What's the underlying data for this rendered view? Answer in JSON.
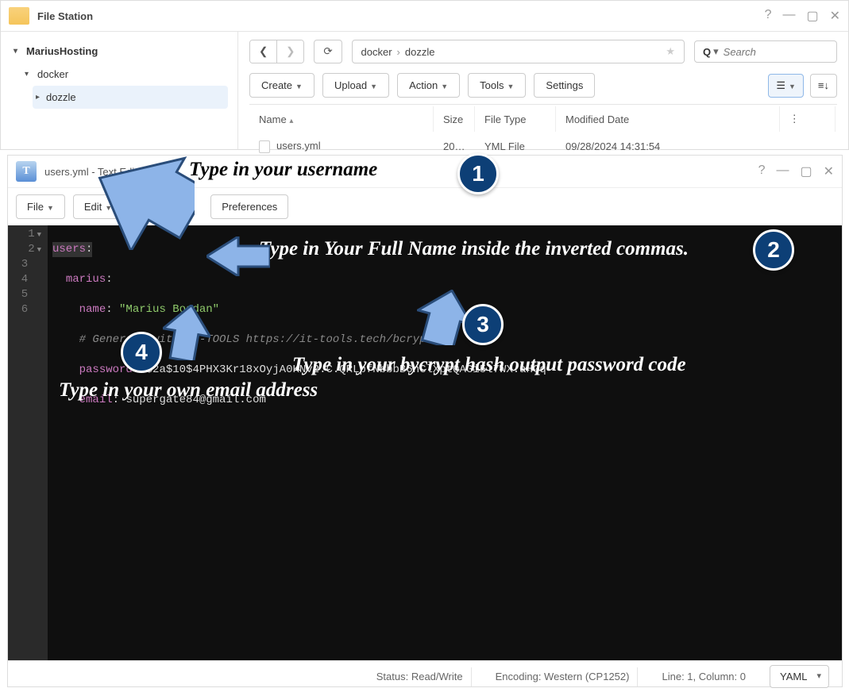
{
  "fileStation": {
    "title": "File Station",
    "tree": {
      "root": "MariusHosting",
      "child": "docker",
      "grandchild": "dozzle"
    },
    "breadcrumb": {
      "seg1": "docker",
      "seg2": "dozzle"
    },
    "search_placeholder": "Search",
    "toolbar": {
      "create": "Create",
      "upload": "Upload",
      "action": "Action",
      "tools": "Tools",
      "settings": "Settings"
    },
    "columns": {
      "name": "Name",
      "size": "Size",
      "filetype": "File Type",
      "modified": "Modified Date"
    },
    "rows": [
      {
        "name": "users.yml",
        "size": "20…",
        "filetype": "YML File",
        "modified": "09/28/2024 14:31:54"
      }
    ]
  },
  "textEditor": {
    "title": "users.yml - Text Editor",
    "menu": {
      "file": "File",
      "edit": "Edit",
      "preferences": "Preferences"
    },
    "code": {
      "l1_k": "users",
      "l1_c": ":",
      "l2_k": "marius",
      "l2_c": ":",
      "l3_k": "name",
      "l3_c": ": ",
      "l3_v": "\"Marius Bogdan\"",
      "l4": "# Generate with IT-TOOLS https://it-tools.tech/bcrypt",
      "l5_k": "password",
      "l5_c": ": ",
      "l5_v": "$2a$10$4PHX3Kr18xOyjA0KNv2.C.QRLpfNbbbB6nClXptQAGi5l7WX.aHGq",
      "l6_k": "email",
      "l6_c": ": ",
      "l6_v": "supergate84@gmail.com"
    },
    "status": {
      "rw": "Status: Read/Write",
      "enc": "Encoding: Western (CP1252)",
      "pos": "Line: 1, Column: 0",
      "lang": "YAML"
    }
  },
  "annotations": {
    "a1": "Type in your username",
    "a2": "Type in Your Full Name inside the inverted commas.",
    "a3": "Type in your bycrypt hash output password code",
    "a4": "Type in your own email address",
    "b1": "1",
    "b2": "2",
    "b3": "3",
    "b4": "4"
  }
}
